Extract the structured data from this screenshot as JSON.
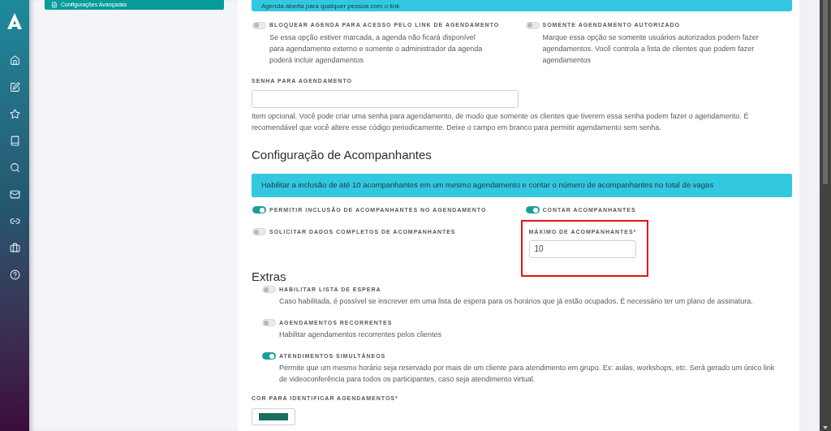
{
  "sidebar": {
    "items": [
      {
        "kind": "logo"
      },
      {
        "kind": "home"
      },
      {
        "kind": "edit"
      },
      {
        "kind": "star"
      },
      {
        "kind": "book"
      },
      {
        "kind": "search"
      },
      {
        "kind": "mail"
      },
      {
        "kind": "link"
      },
      {
        "kind": "briefcase"
      },
      {
        "kind": "help"
      }
    ]
  },
  "left_panel": {
    "card_label": "Configurações Avançadas"
  },
  "top_notice": "Agenda aberta para qualquer pessoa com o link",
  "access_options": [
    {
      "label": "BLOQUEAR AGENDA PARA ACESSO PELO LINK DE AGENDAMENTO",
      "on": false,
      "description": "Se essa opção estiver marcada, a agenda não ficará disponível para agendamento externo e somente o administrador da agenda poderá incluir agendamentos"
    },
    {
      "label": "SOMENTE AGENDAMENTO AUTORIZADO",
      "on": false,
      "description": "Marque essa opção se somente usuários autorizados podem fazer agendamentos. Você controla a lista de clientes que podem fazer agendamentos"
    }
  ],
  "password": {
    "label": "SENHA PARA AGENDAMENTO",
    "help": "Item opcional. Você pode criar uma senha para agendamento, de modo que somente os clientes que tiverem essa senha podem fazer o agendamento. É recomendável que você altere esse código periodicamente. Deixe o campo em branco para permitir agendamento sem senha."
  },
  "companions": {
    "title": "Configuração de Acompanhantes",
    "notice": "Habilitar a inclusão de até 10 acompanhantes em um mesmo agendamento e contar o número de acompanhantes no total de vagas",
    "options": [
      {
        "label": "PERMITIR INCLUSÃO DE ACOMPANHANTES NO AGENDAMENTO",
        "on": true
      },
      {
        "label": "CONTAR ACOMPANHANTES",
        "on": true
      },
      {
        "label": "SOLICITAR DADOS COMPLETOS DE ACOMPANHANTES",
        "on": false
      }
    ],
    "max": {
      "label": "MÁXIMO DE ACOMPANHANTES*",
      "value": "10",
      "highlighted": true
    }
  },
  "extras": {
    "title": "Extras",
    "options": [
      {
        "label": "HABILITAR LISTA DE ESPERA",
        "on": false,
        "description": "Caso habilitada, é possível se inscrever em uma lista de espera para os horários que já estão ocupados. É necessário ter um plano de assinatura."
      },
      {
        "label": "AGENDAMENTOS RECORRENTES",
        "on": false,
        "description": "Habilitar agendamentos recorrentes pelos clientes"
      },
      {
        "label": "ATENDIMENTOS SIMULTÂNEOS",
        "on": true,
        "description": "Permite que um mesmo horário seja reservado por mais de um cliente para atendimento em grupo. Ex: aulas, workshops, etc. Será gerado um único link de videoconferência para todos os participantes, caso seja atendimento virtual."
      }
    ]
  },
  "appointment_color": {
    "label": "COR PARA IDENTIFICAR AGENDAMENTOS*",
    "color": "#1b6f5c"
  }
}
